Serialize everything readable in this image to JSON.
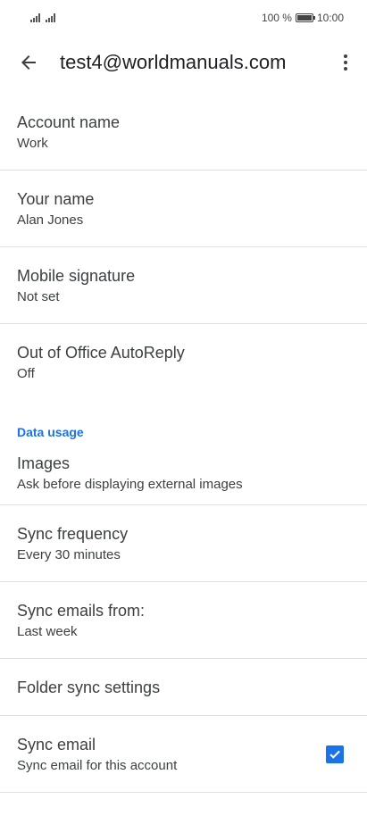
{
  "status_bar": {
    "battery_text": "100 %",
    "time": "10:00"
  },
  "app_bar": {
    "title": "test4@worldmanuals.com",
    "back_icon": "arrow-back-icon",
    "more_icon": "more-vert-icon"
  },
  "settings": {
    "account_name": {
      "title": "Account name",
      "value": "Work"
    },
    "your_name": {
      "title": "Your name",
      "value": "Alan Jones"
    },
    "mobile_signature": {
      "title": "Mobile signature",
      "value": "Not set"
    },
    "out_of_office": {
      "title": "Out of Office AutoReply",
      "value": "Off"
    },
    "data_usage_header": "Data usage",
    "images": {
      "title": "Images",
      "value": "Ask before displaying external images"
    },
    "sync_frequency": {
      "title": "Sync frequency",
      "value": "Every 30 minutes"
    },
    "sync_emails_from": {
      "title": "Sync emails from:",
      "value": "Last week"
    },
    "folder_sync": {
      "title": "Folder sync settings"
    },
    "sync_email": {
      "title": "Sync email",
      "value": "Sync email for this account",
      "checked": true
    }
  },
  "colors": {
    "accent": "#1a73e8",
    "text_primary": "#3c4043",
    "divider": "#e0e0e0"
  }
}
